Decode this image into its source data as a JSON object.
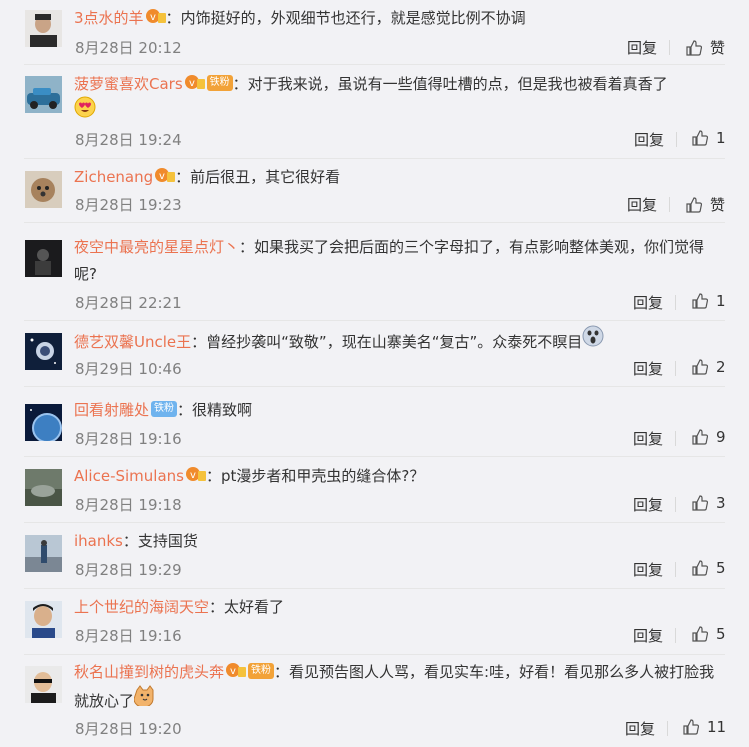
{
  "comments": [
    {
      "username": "3点水的羊",
      "vip": true,
      "fan_badge": "",
      "sep": "：",
      "text": "内饰挺好的，外观细节也还行，就是感觉比例不协调",
      "time": "8月28日 20:12",
      "reply_label": "回复",
      "like_label": "赞"
    },
    {
      "username": "菠萝蜜喜欢Cars",
      "vip": true,
      "fan_badge": "铁粉",
      "sep": "：",
      "text": "对于我来说，虽说有一些值得吐槽的点，但是我也被看着真香了",
      "emoji": "heart-eyes",
      "time": "8月28日 19:24",
      "reply_label": "回复",
      "like_label": "1"
    },
    {
      "username": "Zichenang",
      "vip": true,
      "fan_badge": "",
      "sep": "：",
      "text": "前后很丑，其它很好看",
      "time": "8月28日 19:23",
      "reply_label": "回复",
      "like_label": "赞"
    },
    {
      "username": "夜空中最亮的星星点灯丶",
      "vip": false,
      "fan_badge": "",
      "sep": "：",
      "text": "如果我买了会把后面的三个字母扣了，有点影响整体美观，你们觉得呢?",
      "time": "8月28日 22:21",
      "reply_label": "回复",
      "like_label": "1"
    },
    {
      "username": "德艺双馨Uncle王",
      "vip": false,
      "fan_badge": "",
      "sep": "：",
      "text": "曾经抄袭叫“致敬”，现在山寨美名“复古”。众泰死不瞑目",
      "emoji": "scream",
      "time": "8月29日 10:46",
      "reply_label": "回复",
      "like_label": "2"
    },
    {
      "username": "回看射雕处",
      "vip": false,
      "fan_badge": "铁粉",
      "fan_blue": true,
      "sep": "：",
      "text": "很精致啊",
      "time": "8月28日 19:16",
      "reply_label": "回复",
      "like_label": "9"
    },
    {
      "username": "Alice-Simulans",
      "vip": true,
      "fan_badge": "",
      "sep": "：",
      "text": "pt漫步者和甲壳虫的缝合体?？",
      "time": "8月28日 19:18",
      "reply_label": "回复",
      "like_label": "3"
    },
    {
      "username": "ihanks",
      "vip": false,
      "fan_badge": "",
      "sep": "：",
      "text": "支持国货",
      "time": "8月28日 19:29",
      "reply_label": "回复",
      "like_label": "5"
    },
    {
      "username": "上个世纪的海阔天空",
      "vip": false,
      "fan_badge": "",
      "sep": "：",
      "text": "太好看了",
      "time": "8月28日 19:16",
      "reply_label": "回复",
      "like_label": "5"
    },
    {
      "username": "秋名山撞到树的虎头奔",
      "vip": true,
      "fan_badge": "铁粉",
      "sep": "：",
      "text": "看见预告图人人骂，看见实车:哇，好看！看见那么多人被打脸我就放心了",
      "emoji": "cat",
      "time": "8月28日 19:20",
      "reply_label": "回复",
      "like_label": "11"
    }
  ],
  "colors": {
    "username": "#eb7350",
    "time": "#808080",
    "fan_gold": "#f2a238",
    "fan_blue": "#6fb3ee"
  }
}
